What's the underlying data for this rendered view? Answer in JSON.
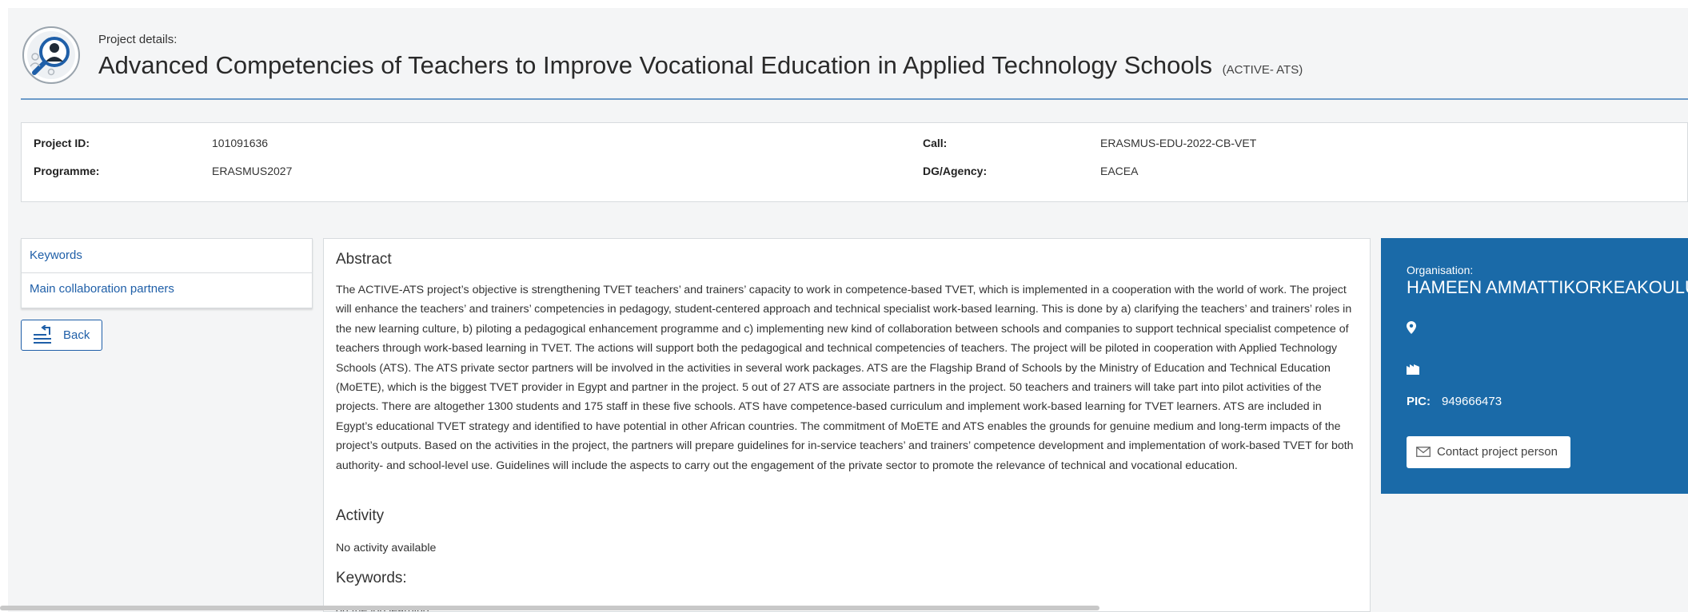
{
  "header": {
    "label": "Project details:",
    "title": "Advanced Competencies of Teachers to Improve Vocational Education in Applied Technology Schools",
    "acronym": "(ACTIVE- ATS)"
  },
  "info": {
    "project_id_label": "Project ID:",
    "project_id": "101091636",
    "programme_label": "Programme:",
    "programme": "ERASMUS2027",
    "call_label": "Call:",
    "call": "ERASMUS-EDU-2022-CB-VET",
    "dg_label": "DG/Agency:",
    "dg": "EACEA"
  },
  "nav": {
    "items": [
      {
        "label": "Keywords"
      },
      {
        "label": "Main collaboration partners"
      }
    ],
    "back_label": "Back"
  },
  "main": {
    "abstract_title": "Abstract",
    "abstract_text": "The ACTIVE-ATS project’s objective is strengthening TVET teachers’ and trainers’ capacity to work in competence-based TVET, which is implemented in a cooperation with the world of work. The project will enhance the teachers’ and trainers’ competencies in pedagogy, student-centered approach and technical specialist work-based learning. This is done by a) clarifying the teachers’ and trainers’ roles in the new learning culture, b) piloting a pedagogical enhancement programme and c) implementing new kind of collaboration between schools and companies to support technical specialist competence of teachers through work-based learning in TVET. The actions will support both the pedagogical and technical competencies of teachers. The project will be piloted in cooperation with Applied Technology Schools (ATS). The ATS private sector partners will be involved in the activities in several work packages. ATS are the Flagship Brand of Schools by the Ministry of Education and Technical Education (MoETE), which is the biggest TVET provider in Egypt and partner in the project. 5 out of 27 ATS are associate partners in the project. 50 teachers and trainers will take part into pilot activities of the projects. There are altogether 1300 students and 175 staff in these five schools. ATS have competence-based curriculum and implement work-based learning for TVET learners. ATS are included in Egypt’s educational TVET strategy and identified to have potential in other African countries. The commitment of MoETE and ATS enables the grounds for genuine medium and long-term impacts of the project’s outputs. Based on the activities in the project, the partners will prepare guidelines for in-service teachers’ and trainers’ competence development and implementation of work-based TVET for both authority- and school-level use. Guidelines will include the aspects to carry out the engagement of the private sector to promote the relevance of technical and vocational education.",
    "activity_title": "Activity",
    "activity_text": "No activity available",
    "keywords_title": "Keywords:",
    "keywords_text": "on the job learning"
  },
  "org": {
    "label": "Organisation:",
    "name": "HAMEEN AMMATTIKORKEAKOULU",
    "pic_label": "PIC:",
    "pic": "949666473",
    "contact_label": "Contact project person",
    "icons": [
      "map-pin-icon",
      "building-icon",
      "envelope-icon"
    ],
    "color": "#1a6aa8"
  }
}
